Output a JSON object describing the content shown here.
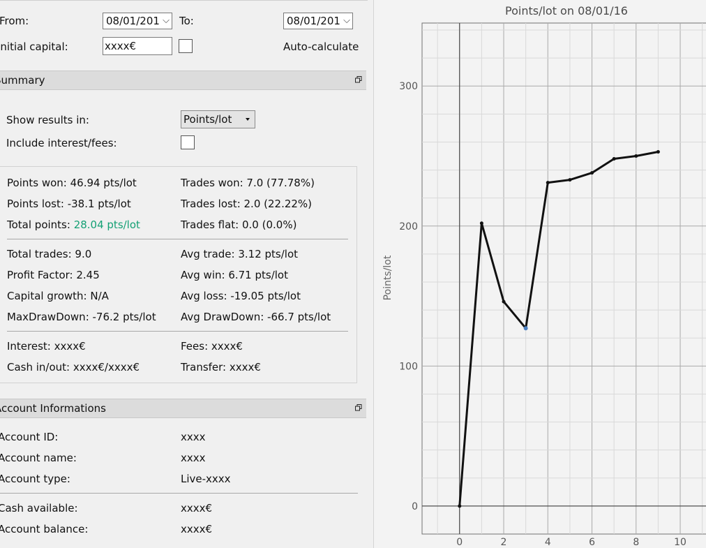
{
  "filters": {
    "from_label": "From:",
    "from_value": "08/01/201",
    "to_label": "To:",
    "to_value": "08/01/201",
    "capital_label": "Initial capital:",
    "capital_value": "xxxx€",
    "auto_label": "Auto-calculate"
  },
  "summary": {
    "header": "Summary",
    "show_results_label": "Show results in:",
    "show_results_value": "Points/lot",
    "include_label": "Include interest/fees:",
    "points_won": "Points won: 46.94 pts/lot",
    "points_lost": "Points lost: -38.1 pts/lot",
    "total_points_label": "Total points: ",
    "total_points_value": "28.04 pts/lot",
    "trades_won": "Trades won: 7.0 (77.78%)",
    "trades_lost": "Trades lost: 2.0 (22.22%)",
    "trades_flat": "Trades flat: 0.0 (0.0%)",
    "total_trades": "Total trades: 9.0",
    "profit_factor": "Profit Factor: 2.45",
    "capital_growth": "Capital growth: N/A",
    "max_drawdown": "MaxDrawDown: -76.2 pts/lot",
    "avg_trade": "Avg trade: 3.12 pts/lot",
    "avg_win": "Avg win: 6.71 pts/lot",
    "avg_loss": "Avg loss: -19.05 pts/lot",
    "avg_drawdown": "Avg DrawDown: -66.7 pts/lot",
    "interest": "Interest: xxxx€",
    "fees": "Fees: xxxx€",
    "cash_inout": "Cash in/out: xxxx€/xxxx€",
    "transfer": "Transfer: xxxx€",
    "accent": "#14a074"
  },
  "account": {
    "header": "Account Informations",
    "rows": [
      {
        "label": "Account ID:",
        "value": "xxxx"
      },
      {
        "label": "Account name:",
        "value": "xxxx"
      },
      {
        "label": "Account type:",
        "value": "Live-xxxx"
      },
      {
        "label": "Cash available:",
        "value": "xxxx€"
      },
      {
        "label": "Account balance:",
        "value": "xxxx€"
      }
    ]
  },
  "chart_data": {
    "type": "line",
    "title": "Points/lot on 08/01/16",
    "ylabel": "Points/lot",
    "xlabel": "",
    "x": [
      0,
      1,
      2,
      3,
      4,
      5,
      6,
      7,
      8,
      9
    ],
    "y": [
      0,
      202,
      146,
      127,
      231,
      233,
      238,
      248,
      250,
      253
    ],
    "highlighted_index": 3,
    "xlim": [
      -1.7,
      11.2
    ],
    "ylim": [
      -20,
      345
    ],
    "x_ticks": [
      0,
      2,
      4,
      6,
      8,
      10
    ],
    "y_ticks": [
      0,
      100,
      200,
      300
    ],
    "grid": true,
    "line_color": "#111111",
    "highlight_color": "#4a7fc1"
  }
}
